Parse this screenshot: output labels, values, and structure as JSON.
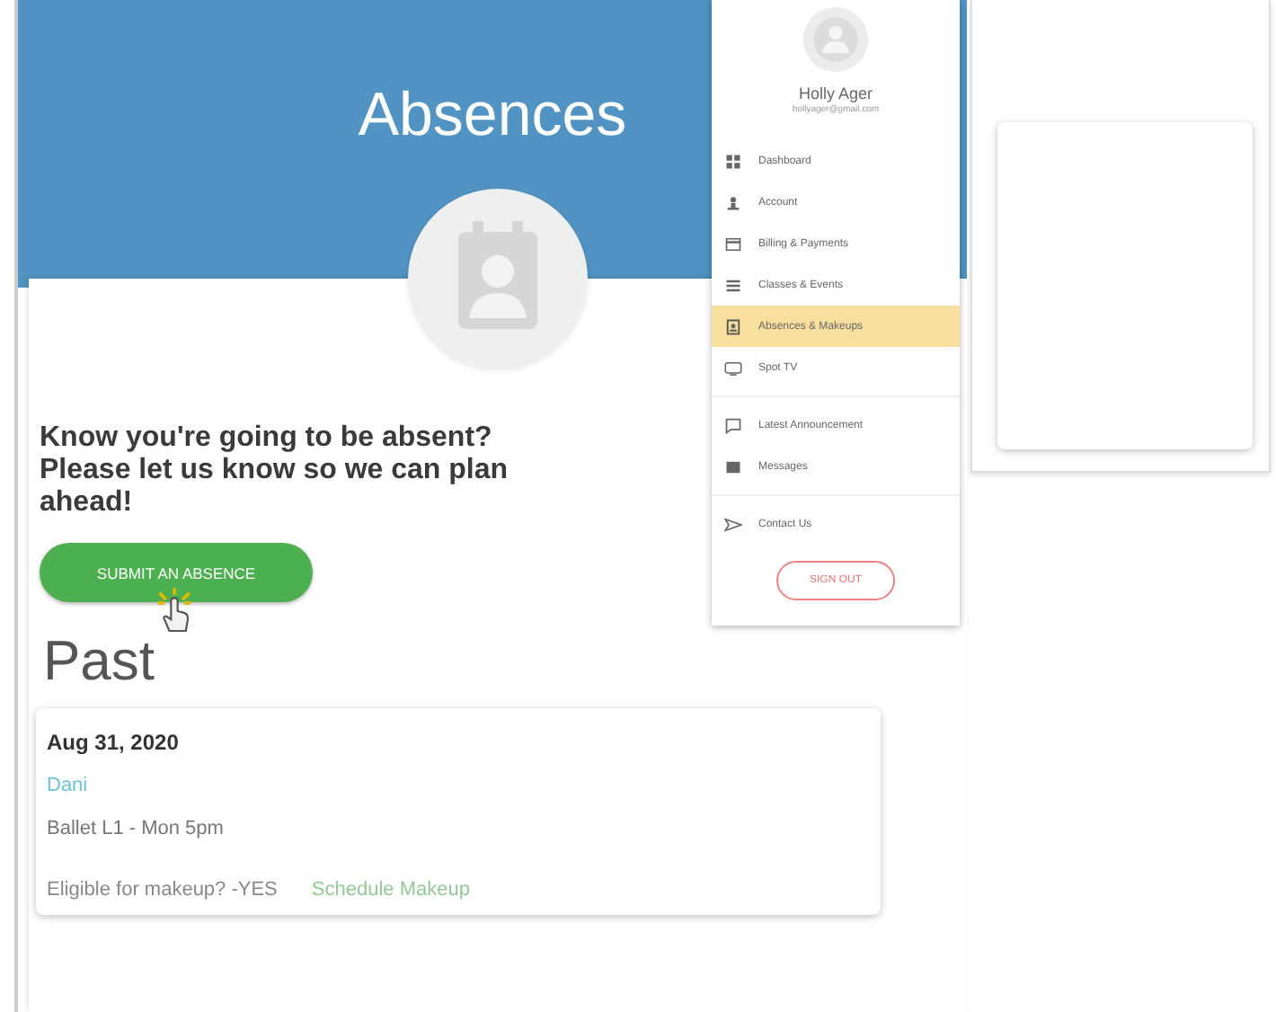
{
  "header": {
    "title": "Absences"
  },
  "prompt": "Know you're going to be absent? Please let us know so we can plan ahead!",
  "submit_button": "SUBMIT AN ABSENCE",
  "section_title": "Past",
  "absences": [
    {
      "date": "Aug 31, 2020",
      "student": "Dani",
      "class": "Ballet L1 - Mon 5pm",
      "eligibility": "Eligible for makeup? -YES",
      "action": "Schedule Makeup"
    }
  ],
  "menu": {
    "user_name": "Holly Ager",
    "user_email": "hollyager@gmail.com",
    "items": [
      {
        "label": "Dashboard",
        "selected": false,
        "divider_before": false
      },
      {
        "label": "Account",
        "selected": false,
        "divider_before": false
      },
      {
        "label": "Billing & Payments",
        "selected": false,
        "divider_before": false
      },
      {
        "label": "Classes & Events",
        "selected": false,
        "divider_before": false
      },
      {
        "label": "Absences & Makeups",
        "selected": true,
        "divider_before": false
      },
      {
        "label": "Spot TV",
        "selected": false,
        "divider_before": false
      },
      {
        "label": "Latest Announcement",
        "selected": false,
        "divider_before": true
      },
      {
        "label": "Messages",
        "selected": false,
        "divider_before": false
      },
      {
        "label": "Contact Us",
        "selected": false,
        "divider_before": true
      }
    ],
    "sign_out": "SIGN OUT"
  }
}
